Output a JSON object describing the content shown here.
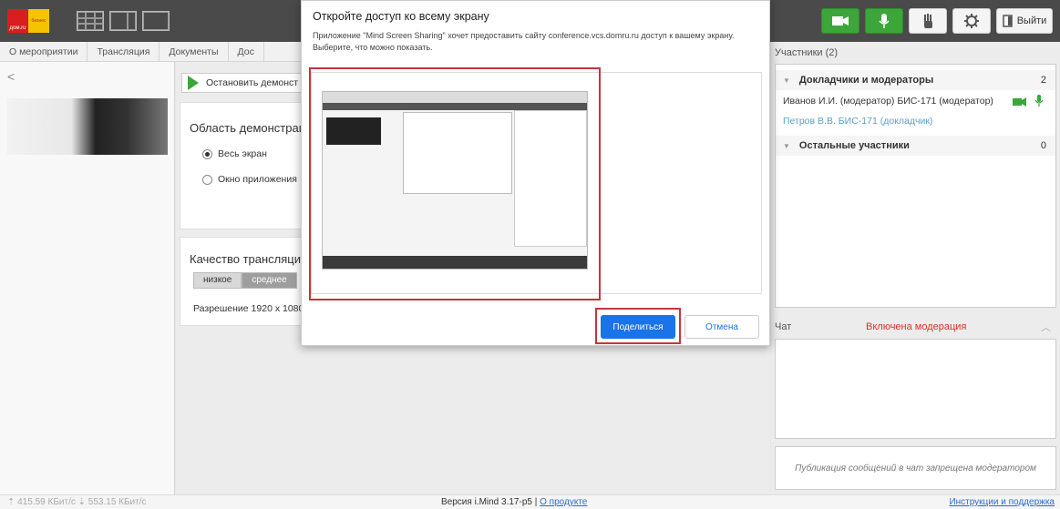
{
  "app": {
    "logo_left": "дом.ru",
    "logo_right": "бизнес"
  },
  "toolbar": {
    "exit_label": "Выйти",
    "camera_icon": "camera-icon",
    "mic_icon": "microphone-icon",
    "hand_icon": "raise-hand-icon",
    "settings_icon": "gear-icon",
    "accent_green": "#3ca63a"
  },
  "tabs": [
    {
      "label": "О мероприятии"
    },
    {
      "label": "Трансляция"
    },
    {
      "label": "Документы"
    },
    {
      "label": "Дос"
    }
  ],
  "main": {
    "stop_label": "Остановить демонст",
    "area_title": "Область демонстрац",
    "option_full": "Весь экран",
    "option_window": "Окно приложения",
    "quality_title": "Качество трансляции",
    "quality_low": "низкое",
    "quality_mid": "среднее",
    "resolution": "Разрешение 1920 x 1080"
  },
  "participants": {
    "header": "Участники (2)",
    "group1": {
      "label": "Докладчики и модераторы",
      "count": "2"
    },
    "person1": "Иванов И.И. (модератор) БИС-171 (модератор)",
    "person2": "Петров В.В. БИС-171 (докладчик)",
    "group2": {
      "label": "Остальные участники",
      "count": "0"
    }
  },
  "chat": {
    "header": "Чат",
    "moderation": "Включена модерация",
    "input_placeholder": "Публикация сообщений в чат запрещена модератором"
  },
  "status": {
    "speed": "⇡ 415.59 КБит/с  ⇣ 553.15 КБит/с",
    "version": "Версия i.Mind 3.17-p5 |",
    "product_link": "О продукте",
    "help_link": "Инструкции и поддержка"
  },
  "modal": {
    "title": "Откройте доступ ко всему экрану",
    "description": "Приложение \"Mind Screen Sharing\" хочет предоставить сайту conference.vcs.domru.ru доступ к вашему экрану. Выберите, что можно показать.",
    "share_label": "Поделиться",
    "cancel_label": "Отмена",
    "accent_blue": "#1a73e8",
    "highlight_red": "#c6353a"
  }
}
